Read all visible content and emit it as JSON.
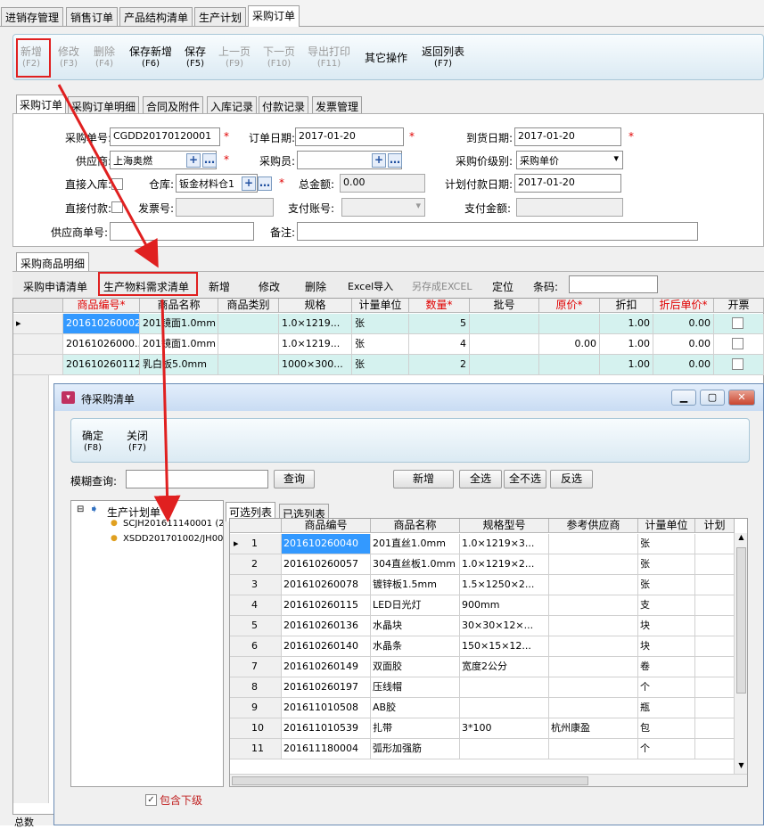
{
  "top_tabs": [
    "进销存管理",
    "销售订单",
    "产品结构清单",
    "生产计划",
    "采购订单"
  ],
  "toolbar": [
    {
      "label": "新增",
      "key": "(F2)",
      "enabled": false
    },
    {
      "label": "修改",
      "key": "(F3)",
      "enabled": false
    },
    {
      "label": "删除",
      "key": "(F4)",
      "enabled": false
    },
    {
      "label": "保存新增",
      "key": "(F6)",
      "enabled": true
    },
    {
      "label": "保存",
      "key": "(F5)",
      "enabled": true
    },
    {
      "label": "上一页",
      "key": "(F9)",
      "enabled": false
    },
    {
      "label": "下一页",
      "key": "(F10)",
      "enabled": false
    },
    {
      "label": "导出打印",
      "key": "(F11)",
      "enabled": false
    },
    {
      "label": "其它操作",
      "key": "",
      "enabled": true
    },
    {
      "label": "返回列表",
      "key": "(F7)",
      "enabled": true
    }
  ],
  "sub_tabs": [
    "采购订单",
    "采购订单明细",
    "合同及附件",
    "入库记录",
    "付款记录",
    "发票管理"
  ],
  "form": {
    "order_no_label": "采购单号:",
    "order_no": "CGDD20170120001",
    "order_date_label": "订单日期:",
    "order_date": "2017-01-20",
    "arrival_label": "到货日期:",
    "arrival_date": "2017-01-20",
    "supplier_label": "供应商:",
    "supplier": "上海奥燃",
    "buyer_label": "采购员:",
    "buyer": "",
    "price_level_label": "采购价级别:",
    "price_level": "采购单价",
    "direct_in_label": "直接入库:",
    "warehouse_label": "仓库:",
    "warehouse": "钣金材料仓1",
    "total_label": "总金额:",
    "total": "0.00",
    "plan_pay_label": "计划付款日期:",
    "plan_pay_date": "2017-01-20",
    "direct_pay_label": "直接付款:",
    "invoice_label": "发票号:",
    "invoice": "",
    "pay_acct_label": "支付账号:",
    "pay_acct": "",
    "pay_amount_label": "支付金额:",
    "pay_amount": "",
    "supplier_no_label": "供应商单号:",
    "supplier_no": "",
    "remark_label": "备注:",
    "remark": ""
  },
  "grid_tab": "采购商品明细",
  "grid_toolbar": [
    "采购申请清单",
    "生产物料需求清单",
    "新增",
    "修改",
    "删除",
    "Excel导入",
    "另存成EXCEL",
    "定位",
    "条码:"
  ],
  "grid_headers": [
    "商品编号*",
    "商品名称",
    "商品类别",
    "规格",
    "计量单位",
    "数量*",
    "批号",
    "原价*",
    "折扣",
    "折后单价*",
    "开票"
  ],
  "grid_rows": [
    {
      "code": "201610260002",
      "name": "201镜面1.0mm",
      "cat": "",
      "spec": "1.0×1219...",
      "unit": "张",
      "qty": "5",
      "batch": "",
      "price": "",
      "disc": "1.00",
      "net": "0.00"
    },
    {
      "code": "20161026000...",
      "name": "201镜面1.0mm",
      "cat": "",
      "spec": "1.0×1219...",
      "unit": "张",
      "qty": "4",
      "batch": "",
      "price": "0.00",
      "disc": "1.00",
      "net": "0.00"
    },
    {
      "code": "201610260112",
      "name": "乳白板5.0mm",
      "cat": "",
      "spec": "1000×300...",
      "unit": "张",
      "qty": "2",
      "batch": "",
      "price": "",
      "disc": "1.00",
      "net": "0.00"
    }
  ],
  "footer_partial": "总数",
  "dialog": {
    "title": "待采购清单",
    "toolbar": [
      {
        "label": "确定",
        "key": "(F8)"
      },
      {
        "label": "关闭",
        "key": "(F7)"
      }
    ],
    "search_label": "模糊查询:",
    "search_value": "",
    "query_btn": "查询",
    "buttons": [
      "新增",
      "全选",
      "全不选",
      "反选"
    ],
    "tabs": [
      "可选列表",
      "已选列表"
    ],
    "tree": {
      "root": "生产计划单",
      "children": [
        "SCJH201611140001 (2",
        "XSDD201701002/JH00"
      ]
    },
    "include_sub": "包含下级",
    "headers": [
      "",
      "商品编号",
      "商品名称",
      "规格型号",
      "参考供应商",
      "计量单位",
      "计划"
    ],
    "rows": [
      {
        "n": "1",
        "code": "201610260040",
        "name": "201直丝1.0mm",
        "spec": "1.0×1219×3...",
        "sup": "",
        "unit": "张"
      },
      {
        "n": "2",
        "code": "201610260057",
        "name": "304直丝板1.0mm",
        "spec": "1.0×1219×2...",
        "sup": "",
        "unit": "张"
      },
      {
        "n": "3",
        "code": "201610260078",
        "name": "镀锌板1.5mm",
        "spec": "1.5×1250×2...",
        "sup": "",
        "unit": "张"
      },
      {
        "n": "4",
        "code": "201610260115",
        "name": "LED日光灯",
        "spec": "900mm",
        "sup": "",
        "unit": "支"
      },
      {
        "n": "5",
        "code": "201610260136",
        "name": "水晶块",
        "spec": "30×30×12×...",
        "sup": "",
        "unit": "块"
      },
      {
        "n": "6",
        "code": "201610260140",
        "name": "水晶条",
        "spec": "150×15×12...",
        "sup": "",
        "unit": "块"
      },
      {
        "n": "7",
        "code": "201610260149",
        "name": "双面胶",
        "spec": "宽度2公分",
        "sup": "",
        "unit": "卷"
      },
      {
        "n": "8",
        "code": "201610260197",
        "name": "压线帽",
        "spec": "",
        "sup": "",
        "unit": "个"
      },
      {
        "n": "9",
        "code": "201611010508",
        "name": "AB胶",
        "spec": "",
        "sup": "",
        "unit": "瓶"
      },
      {
        "n": "10",
        "code": "201611010539",
        "name": "扎带",
        "spec": "3*100",
        "sup": "杭州康盈",
        "unit": "包"
      },
      {
        "n": "11",
        "code": "201611180004",
        "name": "弧形加强筋",
        "spec": "",
        "sup": "",
        "unit": "个"
      }
    ]
  },
  "colors": {
    "accent_red": "#e02020",
    "selected": "#3399ff",
    "teal_row": "#d5f2ef"
  }
}
